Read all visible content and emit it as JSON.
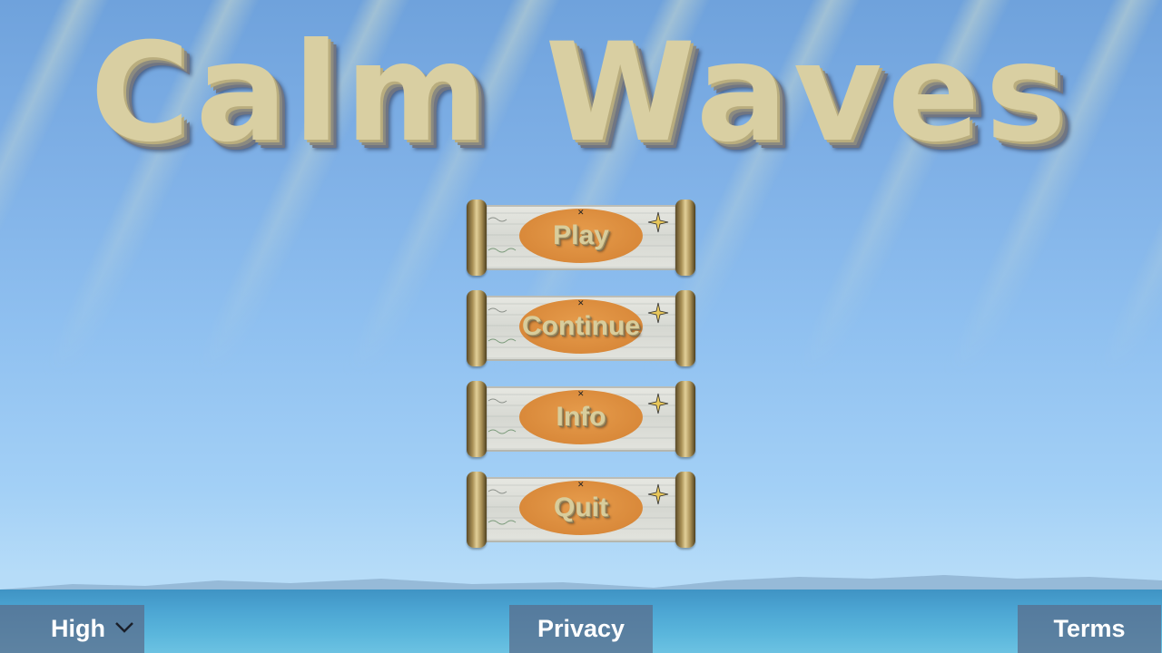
{
  "title": "Calm Waves",
  "menu": {
    "items": [
      {
        "label": "Play"
      },
      {
        "label": "Continue"
      },
      {
        "label": "Info"
      },
      {
        "label": "Quit"
      }
    ]
  },
  "footer": {
    "quality": {
      "selected": "High",
      "icon": "chevron-down-icon"
    },
    "privacy_label": "Privacy",
    "terms_label": "Terms"
  },
  "colors": {
    "sky_top": "#6fa2dc",
    "sky_bottom": "#b6dcf8",
    "sea": "#4ba4d2",
    "button_oval": "#d9893a",
    "sand_text": "#d9cfa2",
    "footer_button": "#5a6e8c"
  }
}
